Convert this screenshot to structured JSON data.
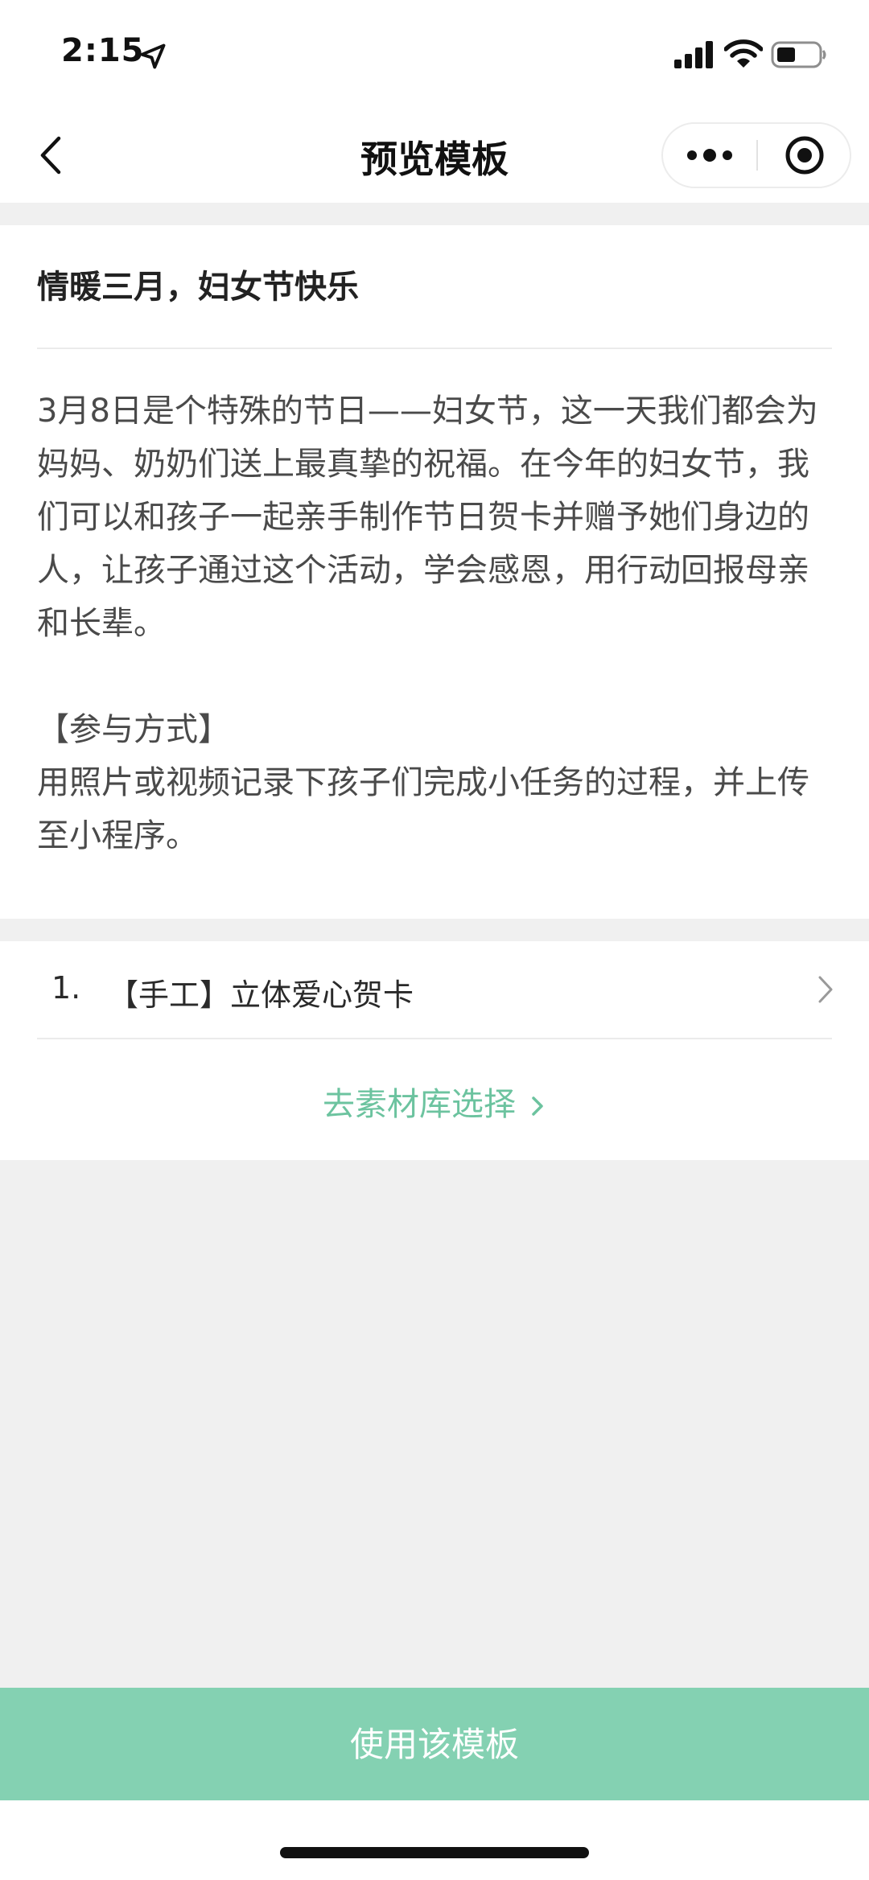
{
  "status_bar": {
    "time": "2:15",
    "icons": [
      "location-arrow-icon",
      "signal-icon",
      "wifi-icon",
      "battery-icon"
    ]
  },
  "nav": {
    "title": "预览模板",
    "icons": [
      "back-icon",
      "more-icon",
      "close-circle-icon"
    ]
  },
  "article": {
    "title": "情暖三月，妇女节快乐",
    "paragraphs": [
      "3月8日是个特殊的节日——妇女节，这一天我们都会为妈妈、奶奶们送上最真挚的祝福。在今年的妇女节，我们可以和孩子一起亲手制作节日贺卡并赠予她们身边的人，让孩子通过这个活动，学会感恩，用行动回报母亲和长辈。",
      "【参与方式】",
      "用照片或视频记录下孩子们完成小任务的过程，并上传至小程序。"
    ]
  },
  "tasks": [
    {
      "index": "1.",
      "label": "【手工】立体爱心贺卡"
    }
  ],
  "library_link": "去素材库选择",
  "use_button": "使用该模板",
  "colors": {
    "accent": "#6cc39f",
    "button_bg": "#84d1b2",
    "page_bg": "#f0f0f0"
  }
}
